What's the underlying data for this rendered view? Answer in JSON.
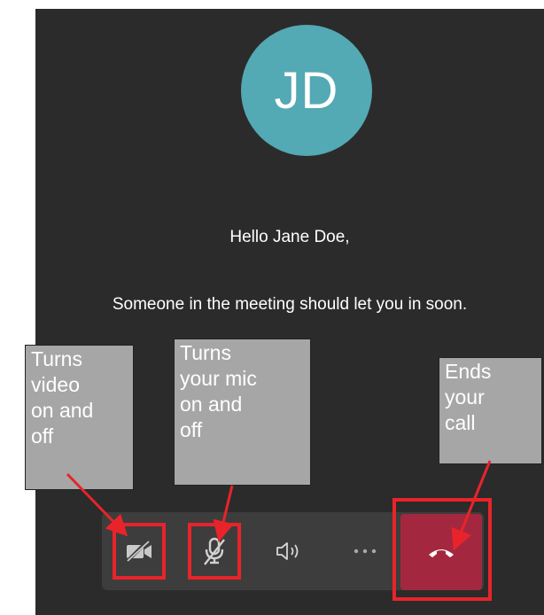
{
  "meeting": {
    "avatar_initials": "JD",
    "greeting": "Hello Jane Doe,",
    "status_message": "Someone in the meeting should let you in soon."
  },
  "toolbar": {
    "video_icon": "video-off-icon",
    "mic_icon": "mic-off-icon",
    "speaker_icon": "speaker-icon",
    "more_icon": "more-options-icon",
    "end_icon": "hang-up-icon"
  },
  "annotations": {
    "video": "Turns\nvideo\non and\noff",
    "mic": "Turns\nyour mic\non and\noff",
    "end": "Ends\nyour\ncall"
  },
  "colors": {
    "screen_bg": "#2b2b2b",
    "toolbar_bg": "#3d3d3d",
    "avatar_bg": "#53a9b4",
    "end_call": "#a3283f",
    "highlight": "#e8242a",
    "callout_bg": "#a6a6a6"
  }
}
